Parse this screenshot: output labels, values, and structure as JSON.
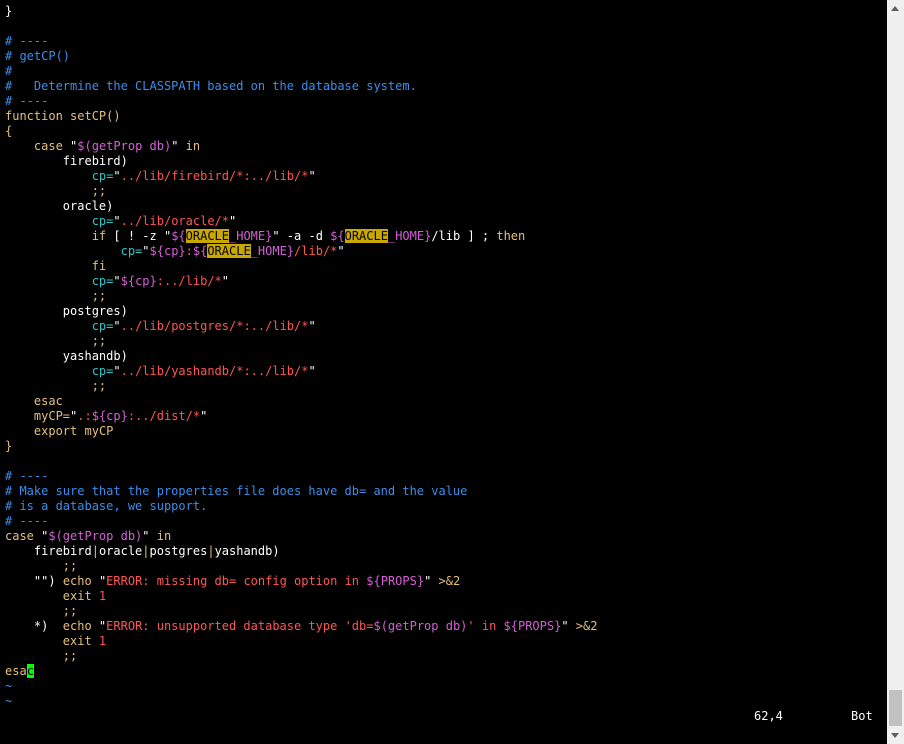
{
  "editor": {
    "lines": [
      [
        {
          "t": "}",
          "c": "op"
        }
      ],
      [],
      [
        {
          "t": "# ----",
          "c": "cmt"
        }
      ],
      [
        {
          "t": "# getCP()",
          "c": "cmt"
        }
      ],
      [
        {
          "t": "#",
          "c": "cmt"
        }
      ],
      [
        {
          "t": "#   Determine the CLASSPATH based on the database system.",
          "c": "cmt"
        }
      ],
      [
        {
          "t": "# ----",
          "c": "cmt"
        }
      ],
      [
        {
          "t": "function setCP()",
          "c": "kw"
        }
      ],
      [
        {
          "t": "{",
          "c": "kw"
        }
      ],
      [
        {
          "t": "    ",
          "c": "op"
        },
        {
          "t": "case",
          "c": "kw"
        },
        {
          "t": " \"",
          "c": "q"
        },
        {
          "t": "$(getProp db)",
          "c": "var"
        },
        {
          "t": "\"",
          "c": "q"
        },
        {
          "t": " in",
          "c": "kw"
        }
      ],
      [
        {
          "t": "        firebird)",
          "c": "op"
        }
      ],
      [
        {
          "t": "            ",
          "c": "op"
        },
        {
          "t": "cp=",
          "c": "cyan"
        },
        {
          "t": "\"",
          "c": "q"
        },
        {
          "t": "../lib/firebird/*:../lib/*",
          "c": "str"
        },
        {
          "t": "\"",
          "c": "q"
        }
      ],
      [
        {
          "t": "            ",
          "c": "op"
        },
        {
          "t": ";;",
          "c": "kw"
        }
      ],
      [
        {
          "t": "        oracle)",
          "c": "op"
        }
      ],
      [
        {
          "t": "            ",
          "c": "op"
        },
        {
          "t": "cp=",
          "c": "cyan"
        },
        {
          "t": "\"",
          "c": "q"
        },
        {
          "t": "../lib/oracle/*",
          "c": "str"
        },
        {
          "t": "\"",
          "c": "q"
        }
      ],
      [
        {
          "t": "            ",
          "c": "op"
        },
        {
          "t": "if",
          "c": "kw"
        },
        {
          "t": " [ ! -z \"",
          "c": "op"
        },
        {
          "t": "${",
          "c": "var"
        },
        {
          "t": "ORACLE",
          "c": "hl"
        },
        {
          "t": "_HOME}",
          "c": "var"
        },
        {
          "t": "\" -a -d ",
          "c": "op"
        },
        {
          "t": "${",
          "c": "var"
        },
        {
          "t": "ORACLE",
          "c": "hl"
        },
        {
          "t": "_HOME}",
          "c": "var"
        },
        {
          "t": "/lib ] ; ",
          "c": "op"
        },
        {
          "t": "then",
          "c": "kw"
        }
      ],
      [
        {
          "t": "                ",
          "c": "op"
        },
        {
          "t": "cp=",
          "c": "cyan"
        },
        {
          "t": "\"",
          "c": "q"
        },
        {
          "t": "${cp}",
          "c": "var"
        },
        {
          "t": ":",
          "c": "str"
        },
        {
          "t": "${",
          "c": "var"
        },
        {
          "t": "ORACLE",
          "c": "hl"
        },
        {
          "t": "_HOME}",
          "c": "var"
        },
        {
          "t": "/lib/*",
          "c": "str"
        },
        {
          "t": "\"",
          "c": "q"
        }
      ],
      [
        {
          "t": "            ",
          "c": "op"
        },
        {
          "t": "fi",
          "c": "kw"
        }
      ],
      [
        {
          "t": "            ",
          "c": "op"
        },
        {
          "t": "cp=",
          "c": "cyan"
        },
        {
          "t": "\"",
          "c": "q"
        },
        {
          "t": "${cp}",
          "c": "var"
        },
        {
          "t": ":../lib/*",
          "c": "str"
        },
        {
          "t": "\"",
          "c": "q"
        }
      ],
      [
        {
          "t": "            ",
          "c": "op"
        },
        {
          "t": ";;",
          "c": "kw"
        }
      ],
      [
        {
          "t": "        postgres)",
          "c": "op"
        }
      ],
      [
        {
          "t": "            ",
          "c": "op"
        },
        {
          "t": "cp=",
          "c": "cyan"
        },
        {
          "t": "\"",
          "c": "q"
        },
        {
          "t": "../lib/postgres/*:../lib/*",
          "c": "str"
        },
        {
          "t": "\"",
          "c": "q"
        }
      ],
      [
        {
          "t": "            ",
          "c": "op"
        },
        {
          "t": ";;",
          "c": "kw"
        }
      ],
      [
        {
          "t": "        yashandb)",
          "c": "op"
        }
      ],
      [
        {
          "t": "            ",
          "c": "op"
        },
        {
          "t": "cp=",
          "c": "cyan"
        },
        {
          "t": "\"",
          "c": "q"
        },
        {
          "t": "../lib/yashandb/*:../lib/*",
          "c": "str"
        },
        {
          "t": "\"",
          "c": "q"
        }
      ],
      [
        {
          "t": "            ",
          "c": "op"
        },
        {
          "t": ";;",
          "c": "kw"
        }
      ],
      [
        {
          "t": "    ",
          "c": "op"
        },
        {
          "t": "esac",
          "c": "kw"
        }
      ],
      [
        {
          "t": "    ",
          "c": "op"
        },
        {
          "t": "myCP=",
          "c": "kw"
        },
        {
          "t": "\"",
          "c": "q"
        },
        {
          "t": ".:",
          "c": "str"
        },
        {
          "t": "${cp}",
          "c": "var"
        },
        {
          "t": ":../dist/*",
          "c": "str"
        },
        {
          "t": "\"",
          "c": "q"
        }
      ],
      [
        {
          "t": "    ",
          "c": "op"
        },
        {
          "t": "export",
          "c": "kw"
        },
        {
          "t": " myCP",
          "c": "kw"
        }
      ],
      [
        {
          "t": "}",
          "c": "kw"
        }
      ],
      [],
      [
        {
          "t": "# ----",
          "c": "cmt"
        }
      ],
      [
        {
          "t": "# Make sure that the properties file does have db= and the value",
          "c": "cmt"
        }
      ],
      [
        {
          "t": "# is a database, we support.",
          "c": "cmt"
        }
      ],
      [
        {
          "t": "# ----",
          "c": "cmt"
        }
      ],
      [
        {
          "t": "case",
          "c": "kw"
        },
        {
          "t": " \"",
          "c": "q"
        },
        {
          "t": "$(getProp db)",
          "c": "var"
        },
        {
          "t": "\"",
          "c": "q"
        },
        {
          "t": " in",
          "c": "kw"
        }
      ],
      [
        {
          "t": "    firebird",
          "c": "op"
        },
        {
          "t": "|",
          "c": "kw"
        },
        {
          "t": "oracle",
          "c": "op"
        },
        {
          "t": "|",
          "c": "kw"
        },
        {
          "t": "postgres",
          "c": "op"
        },
        {
          "t": "|",
          "c": "kw"
        },
        {
          "t": "yashandb)",
          "c": "op"
        }
      ],
      [
        {
          "t": "        ",
          "c": "op"
        },
        {
          "t": ";;",
          "c": "kw"
        }
      ],
      [
        {
          "t": "    ",
          "c": "op"
        },
        {
          "t": "\"\")",
          "c": "op"
        },
        {
          "t": " echo",
          "c": "kw"
        },
        {
          "t": " \"",
          "c": "q"
        },
        {
          "t": "ERROR: missing db= config option in ",
          "c": "str"
        },
        {
          "t": "${PROPS}",
          "c": "var"
        },
        {
          "t": "\"",
          "c": "q"
        },
        {
          "t": " >&2",
          "c": "kw"
        }
      ],
      [
        {
          "t": "        ",
          "c": "op"
        },
        {
          "t": "exit",
          "c": "kw"
        },
        {
          "t": " 1",
          "c": "num"
        }
      ],
      [
        {
          "t": "        ",
          "c": "op"
        },
        {
          "t": ";;",
          "c": "kw"
        }
      ],
      [
        {
          "t": "    *)  ",
          "c": "op"
        },
        {
          "t": "echo",
          "c": "kw"
        },
        {
          "t": " \"",
          "c": "q"
        },
        {
          "t": "ERROR: unsupported database type 'db=",
          "c": "str"
        },
        {
          "t": "$(getProp db)",
          "c": "var"
        },
        {
          "t": "' in ",
          "c": "str"
        },
        {
          "t": "${PROPS}",
          "c": "var"
        },
        {
          "t": "\"",
          "c": "q"
        },
        {
          "t": " >&2",
          "c": "kw"
        }
      ],
      [
        {
          "t": "        ",
          "c": "op"
        },
        {
          "t": "exit",
          "c": "kw"
        },
        {
          "t": " 1",
          "c": "num"
        }
      ],
      [
        {
          "t": "        ",
          "c": "op"
        },
        {
          "t": ";;",
          "c": "kw"
        }
      ],
      [
        {
          "t": "esa",
          "c": "kw"
        },
        {
          "t": "c",
          "c": "cursor"
        }
      ],
      [
        {
          "t": "~",
          "c": "tilde"
        }
      ],
      [
        {
          "t": "~",
          "c": "tilde"
        }
      ]
    ]
  },
  "status": {
    "position": "62,4",
    "scroll": "Bot"
  },
  "colors": {
    "background": "#000000",
    "comment": "#3b8eea",
    "keyword": "#e5c07b",
    "string": "#ff5555",
    "variable": "#d65fd6",
    "highlight": "#c9a800",
    "cursor": "#00ff00"
  }
}
